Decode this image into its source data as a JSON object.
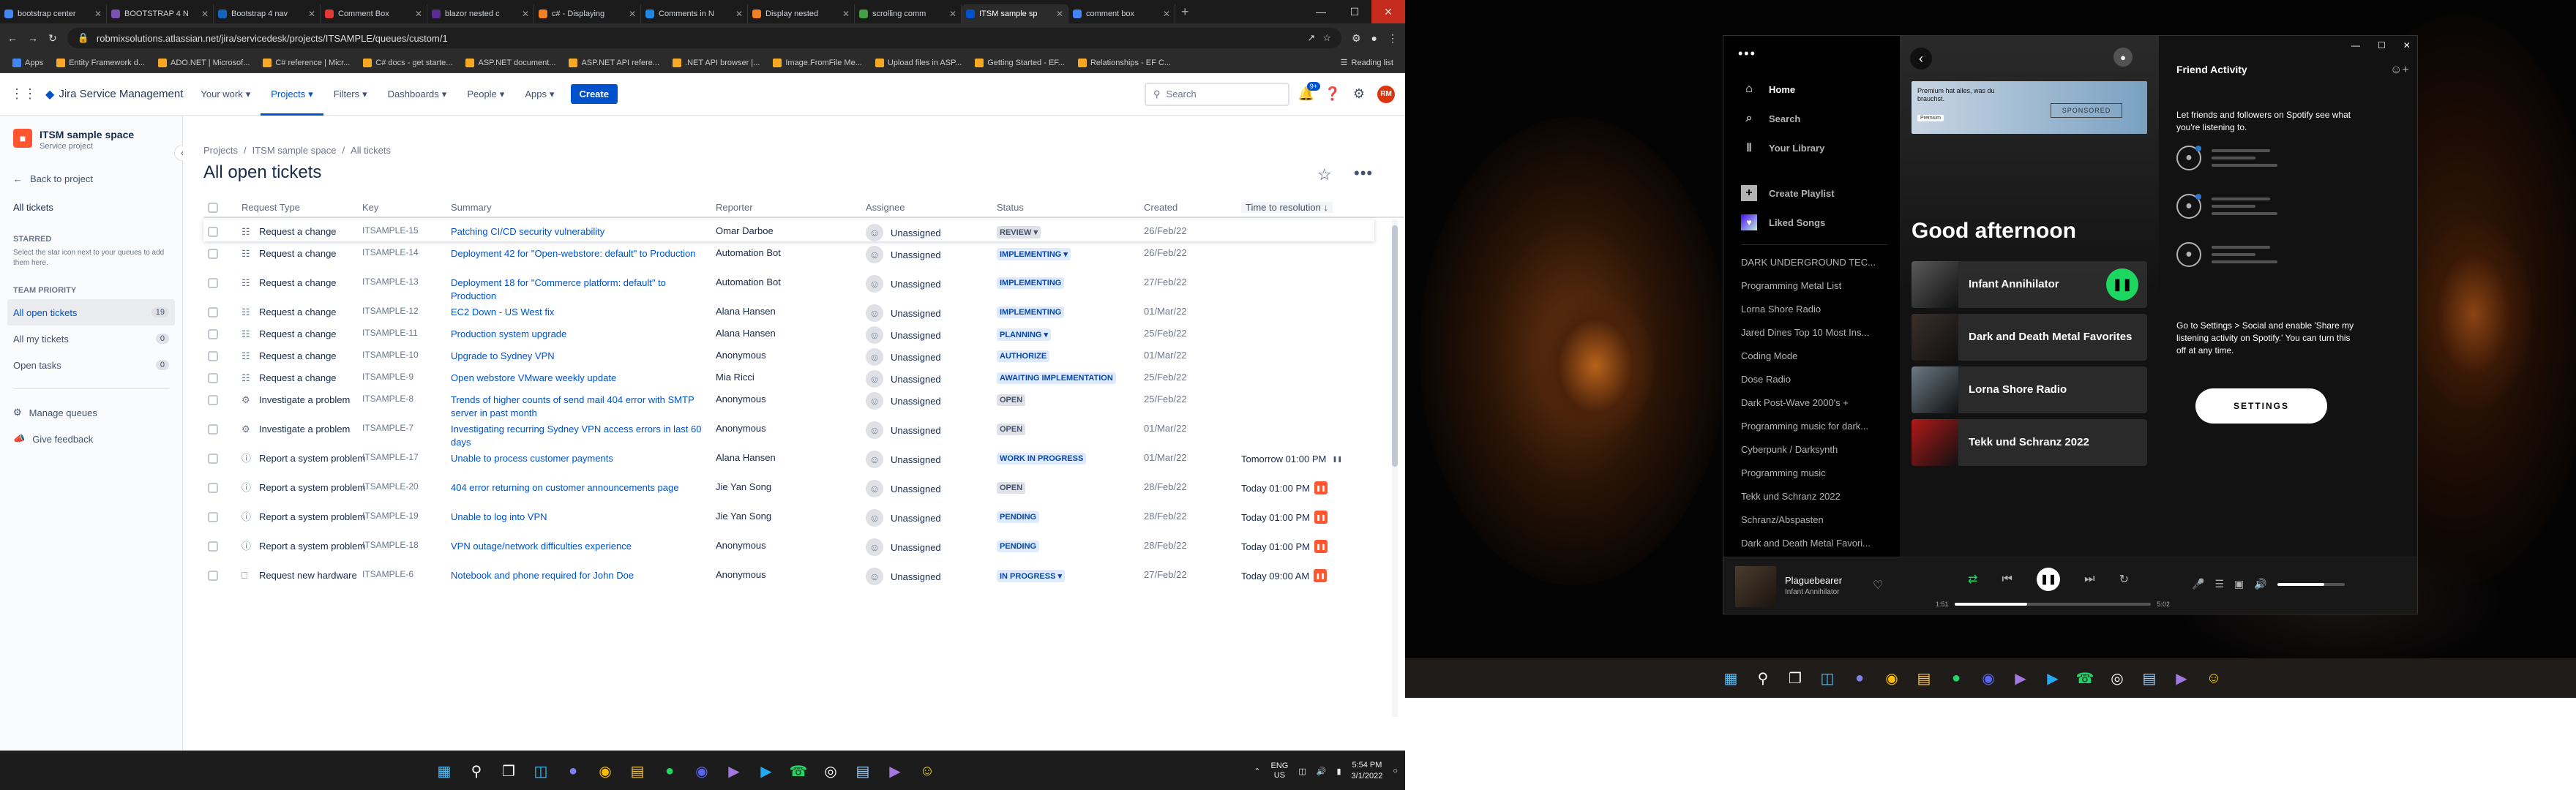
{
  "browser": {
    "tabs": [
      {
        "title": "bootstrap center",
        "color": "#4285f4"
      },
      {
        "title": "BOOTSTRAP 4 N",
        "color": "#7952b3"
      },
      {
        "title": "Bootstrap 4 nav",
        "color": "#1565c0"
      },
      {
        "title": "Comment Box",
        "color": "#e53935"
      },
      {
        "title": "blazor nested c",
        "color": "#5c2d91"
      },
      {
        "title": "c# - Displaying",
        "color": "#f48024"
      },
      {
        "title": "Comments in N",
        "color": "#1e88e5"
      },
      {
        "title": "Display nested",
        "color": "#f48024"
      },
      {
        "title": "scrolling comm",
        "color": "#43a047"
      },
      {
        "title": "ITSM sample sp",
        "color": "#0052cc"
      },
      {
        "title": "comment box",
        "color": "#4285f4"
      }
    ],
    "active_tab": 9,
    "url": "robmixsolutions.atlassian.net/jira/servicedesk/projects/ITSAMPLE/queues/custom/1",
    "bookmarks": [
      {
        "label": "Apps",
        "color": "#4285f4"
      },
      {
        "label": "Entity Framework d...",
        "color": "#f9a825"
      },
      {
        "label": "ADO.NET | Microsof...",
        "color": "#f9a825"
      },
      {
        "label": "C# reference | Micr...",
        "color": "#f9a825"
      },
      {
        "label": "C# docs - get starte...",
        "color": "#f9a825"
      },
      {
        "label": "ASP.NET document...",
        "color": "#f9a825"
      },
      {
        "label": "ASP.NET API refere...",
        "color": "#f9a825"
      },
      {
        "label": ".NET API browser |...",
        "color": "#f9a825"
      },
      {
        "label": "Image.FromFile Me...",
        "color": "#f9a825"
      },
      {
        "label": "Upload files in ASP...",
        "color": "#f9a825"
      },
      {
        "label": "Getting Started - EF...",
        "color": "#f9a825"
      },
      {
        "label": "Relationships - EF C...",
        "color": "#f9a825"
      }
    ],
    "reading_list": "Reading list"
  },
  "jira": {
    "product": "Jira Service Management",
    "nav": [
      "Your work",
      "Projects",
      "Filters",
      "Dashboards",
      "People",
      "Apps"
    ],
    "create": "Create",
    "search_placeholder": "Search",
    "notif_count": "9+",
    "avatar_initials": "RM",
    "project_name": "ITSM sample space",
    "project_type": "Service project",
    "back": "Back to project",
    "all_tickets": "All tickets",
    "starred_head": "STARRED",
    "starred_hint": "Select the star icon next to your queues to add them here.",
    "team_priority": "TEAM PRIORITY",
    "queues": [
      {
        "label": "All open tickets",
        "count": "19"
      },
      {
        "label": "All my tickets",
        "count": "0"
      },
      {
        "label": "Open tasks",
        "count": "0"
      }
    ],
    "manage_queues": "Manage queues",
    "give_feedback": "Give feedback",
    "breadcrumb": [
      "Projects",
      "ITSM sample space",
      "All tickets"
    ],
    "title": "All open tickets",
    "columns": [
      "Request Type",
      "Key",
      "Summary",
      "Reporter",
      "Assignee",
      "Status",
      "Created",
      "Time to resolution ↓"
    ],
    "rows": [
      {
        "type": "Request a change",
        "icon": "change-icon",
        "key": "ITSAMPLE-15",
        "summary": "Patching CI/CD security vulnerability",
        "reporter": "Omar Darboe",
        "assignee": "Unassigned",
        "status": "REVIEW ▾",
        "status_bg": "#dfe1e6",
        "status_fg": "#42526e",
        "created": "26/Feb/22",
        "ttr": "",
        "sla": ""
      },
      {
        "type": "Request a change",
        "icon": "change-icon",
        "key": "ITSAMPLE-14",
        "summary": "Deployment 42 for \"Open-webstore: default\" to Production",
        "reporter": "Automation Bot",
        "assignee": "Unassigned",
        "status": "IMPLEMENTING ▾",
        "status_bg": "#deebff",
        "status_fg": "#0747a6",
        "created": "26/Feb/22",
        "ttr": "",
        "sla": ""
      },
      {
        "type": "Request a change",
        "icon": "change-icon",
        "key": "ITSAMPLE-13",
        "summary": "Deployment 18 for \"Commerce platform: default\" to Production",
        "reporter": "Automation Bot",
        "assignee": "Unassigned",
        "status": "IMPLEMENTING",
        "status_bg": "#deebff",
        "status_fg": "#0747a6",
        "created": "27/Feb/22",
        "ttr": "",
        "sla": ""
      },
      {
        "type": "Request a change",
        "icon": "change-icon",
        "key": "ITSAMPLE-12",
        "summary": "EC2 Down - US West fix",
        "reporter": "Alana Hansen",
        "assignee": "Unassigned",
        "status": "IMPLEMENTING",
        "status_bg": "#deebff",
        "status_fg": "#0747a6",
        "created": "01/Mar/22",
        "ttr": "",
        "sla": ""
      },
      {
        "type": "Request a change",
        "icon": "change-icon",
        "key": "ITSAMPLE-11",
        "summary": "Production system upgrade",
        "reporter": "Alana Hansen",
        "assignee": "Unassigned",
        "status": "PLANNING ▾",
        "status_bg": "#deebff",
        "status_fg": "#0747a6",
        "created": "25/Feb/22",
        "ttr": "",
        "sla": ""
      },
      {
        "type": "Request a change",
        "icon": "change-icon",
        "key": "ITSAMPLE-10",
        "summary": "Upgrade to Sydney VPN",
        "reporter": "Anonymous",
        "assignee": "Unassigned",
        "status": "AUTHORIZE",
        "status_bg": "#deebff",
        "status_fg": "#0747a6",
        "created": "01/Mar/22",
        "ttr": "",
        "sla": ""
      },
      {
        "type": "Request a change",
        "icon": "change-icon",
        "key": "ITSAMPLE-9",
        "summary": "Open webstore VMware weekly update",
        "reporter": "Mia Ricci",
        "assignee": "Unassigned",
        "status": "AWAITING IMPLEMENTATION",
        "status_bg": "#deebff",
        "status_fg": "#0747a6",
        "created": "25/Feb/22",
        "ttr": "",
        "sla": ""
      },
      {
        "type": "Investigate a problem",
        "icon": "problem-icon",
        "key": "ITSAMPLE-8",
        "summary": "Trends of higher counts of send mail 404 error with SMTP server in past month",
        "reporter": "Anonymous",
        "assignee": "Unassigned",
        "status": "OPEN",
        "status_bg": "#dfe1e6",
        "status_fg": "#42526e",
        "created": "25/Feb/22",
        "ttr": "",
        "sla": ""
      },
      {
        "type": "Investigate a problem",
        "icon": "problem-icon",
        "key": "ITSAMPLE-7",
        "summary": "Investigating recurring Sydney VPN access errors in last 60 days",
        "reporter": "Anonymous",
        "assignee": "Unassigned",
        "status": "OPEN",
        "status_bg": "#dfe1e6",
        "status_fg": "#42526e",
        "created": "01/Mar/22",
        "ttr": "",
        "sla": ""
      },
      {
        "type": "Report a system problem",
        "icon": "incident-icon",
        "key": "ITSAMPLE-17",
        "summary": "Unable to process customer payments",
        "reporter": "Alana Hansen",
        "assignee": "Unassigned",
        "status": "WORK IN PROGRESS",
        "status_bg": "#deebff",
        "status_fg": "#0747a6",
        "created": "01/Mar/22",
        "ttr": "Tomorrow 01:00 PM",
        "sla": "paused"
      },
      {
        "type": "Report a system problem",
        "icon": "incident-icon",
        "key": "ITSAMPLE-20",
        "summary": "404 error returning on customer announcements page",
        "reporter": "Jie Yan Song",
        "assignee": "Unassigned",
        "status": "OPEN",
        "status_bg": "#dfe1e6",
        "status_fg": "#42526e",
        "created": "28/Feb/22",
        "ttr": "Today 01:00 PM",
        "sla": "red"
      },
      {
        "type": "Report a system problem",
        "icon": "incident-icon",
        "key": "ITSAMPLE-19",
        "summary": "Unable to log into VPN",
        "reporter": "Jie Yan Song",
        "assignee": "Unassigned",
        "status": "PENDING",
        "status_bg": "#deebff",
        "status_fg": "#0747a6",
        "created": "28/Feb/22",
        "ttr": "Today 01:00 PM",
        "sla": "red"
      },
      {
        "type": "Report a system problem",
        "icon": "incident-icon",
        "key": "ITSAMPLE-18",
        "summary": "VPN outage/network difficulties experience",
        "reporter": "Anonymous",
        "assignee": "Unassigned",
        "status": "PENDING",
        "status_bg": "#deebff",
        "status_fg": "#0747a6",
        "created": "28/Feb/22",
        "ttr": "Today 01:00 PM",
        "sla": "red"
      },
      {
        "type": "Request new hardware",
        "icon": "hardware-icon",
        "key": "ITSAMPLE-6",
        "summary": "Notebook and phone required for John Doe",
        "reporter": "Anonymous",
        "assignee": "Unassigned",
        "status": "IN PROGRESS ▾",
        "status_bg": "#deebff",
        "status_fg": "#0747a6",
        "created": "27/Feb/22",
        "ttr": "Today 09:00 AM",
        "sla": "red"
      }
    ]
  },
  "taskbar_left": {
    "lang": "ENG",
    "region": "US",
    "time": "5:54 PM",
    "date": "3/1/2022"
  },
  "spotify": {
    "nav": [
      "Home",
      "Search",
      "Your Library"
    ],
    "create_playlist": "Create Playlist",
    "liked_songs": "Liked Songs",
    "playlists": [
      "DARK UNDERGROUND TEC...",
      "Programming Metal List",
      "Lorna Shore Radio",
      "Jared Dines Top 10 Most Ins...",
      "Coding Mode",
      "Dose Radio",
      "Dark Post-Wave 2000's +",
      "Programming music for dark...",
      "Cyberpunk / Darksynth",
      "Programming music",
      "Tekk und Schranz 2022",
      "Schranz/Abspasten",
      "Dark and Death Metal Favori..."
    ],
    "ad_text": "Premium hat alles, was du brauchst.",
    "ad_brand": "Premium",
    "ad_label": "SPONSORED",
    "greeting": "Good afternoon",
    "tiles": [
      {
        "title": "Infant Annihilator",
        "color": "#5a5a5a"
      },
      {
        "title": "Dark and Death Metal Favorites",
        "color": "#3a2f2a"
      },
      {
        "title": "Lorna Shore Radio",
        "color": "#6b7a85"
      },
      {
        "title": "Tekk und Schranz 2022",
        "color": "#b01818"
      }
    ],
    "friend_title": "Friend Activity",
    "friend_desc": "Let friends and followers on Spotify see what you're listening to.",
    "friend_hint": "Go to Settings > Social and enable 'Share my listening activity on Spotify.' You can turn this off at any time.",
    "settings": "SETTINGS",
    "now_title": "Plaguebearer",
    "now_artist": "Infant Annihilator",
    "elapsed": "1:51",
    "duration": "5:02",
    "progress": 0.37,
    "volume": 0.7
  }
}
